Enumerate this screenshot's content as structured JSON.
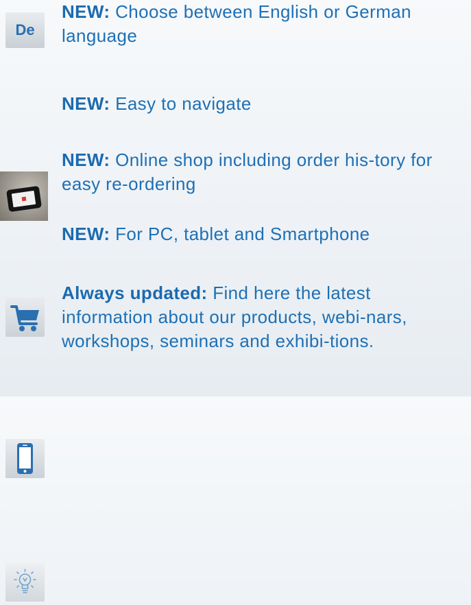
{
  "features": [
    {
      "icon": "language-de-icon",
      "icon_text": "De",
      "bold": "NEW:",
      "text": " Choose between English or German language"
    },
    {
      "icon": "tablet-photo-icon",
      "bold": "NEW:",
      "text": " Easy to navigate"
    },
    {
      "icon": "shopping-cart-icon",
      "bold": "NEW:",
      "text": " Online shop including order his-tory for easy re-ordering"
    },
    {
      "icon": "smartphone-icon",
      "bold": "NEW:",
      "text": " For PC, tablet and Smartphone"
    },
    {
      "icon": "lightbulb-icon",
      "bold": "Always updated:",
      "text": " Find here the latest information about our products, webi-nars, workshops, seminars and exhibi-tions."
    }
  ],
  "colors": {
    "text": "#1e70b5",
    "icon_accent": "#2a6fb0",
    "icon_bg": "#d9dee3"
  }
}
